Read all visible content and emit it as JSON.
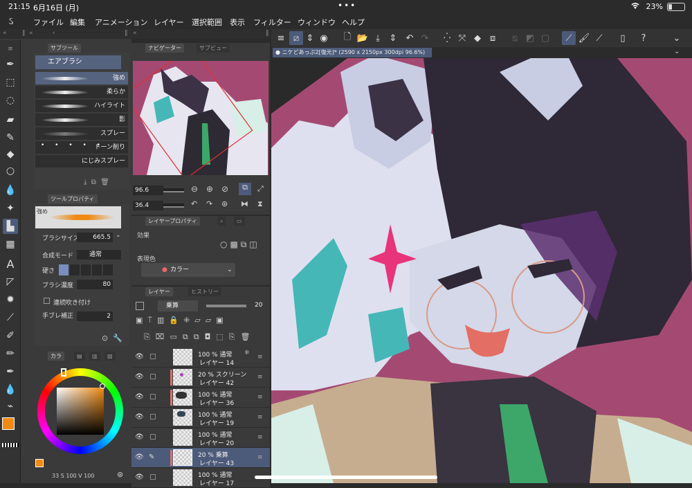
{
  "status": {
    "time": "21:15",
    "date": "6月16日 (月)",
    "battery": "23%"
  },
  "menu": [
    "ファイル",
    "編集",
    "アニメーション",
    "レイヤー",
    "選択範囲",
    "表示",
    "フィルター",
    "ウィンドウ",
    "ヘルプ"
  ],
  "subtool": {
    "tab": "サブツール",
    "group": "エアブラシ",
    "brushes": [
      "強め",
      "柔らか",
      "ハイライト",
      "影",
      "スプレー",
      "トーン削り",
      "にじみスプレー"
    ]
  },
  "toolprop": {
    "tab": "ツールプロパティ",
    "preview_label": "強め",
    "brush_size_label": "ブラシサイズ",
    "brush_size": "665.5",
    "blend_label": "合成モード",
    "blend": "通常",
    "hardness_label": "硬さ",
    "density_label": "ブラシ濃度",
    "density": "80",
    "continuous": "連続吹き付け",
    "stabilize_label": "手ブレ補正",
    "stabilize": "2"
  },
  "colorpanel": {
    "tab": "カラ",
    "readout": "33 S 100 V 100"
  },
  "navigator": {
    "tab": "ナビゲーター",
    "tab2": "サブビュー",
    "zoom": "96.6",
    "angle": "36.4"
  },
  "layerprop": {
    "tab": "レイヤープロパティ",
    "effect": "効果",
    "display_color": "表現色",
    "color_value": "カラー"
  },
  "layers": {
    "tab": "レイヤー",
    "tab2": "ヒストリー",
    "blend": "乗算",
    "opacity": "20",
    "list": [
      {
        "line1": "100 % 通常",
        "line2": "レイヤー 14",
        "marked": false,
        "selected": false,
        "eye": true
      },
      {
        "line1": "20 % スクリーン",
        "line2": "レイヤー 42",
        "marked": true,
        "selected": false,
        "eye": true
      },
      {
        "line1": "100 % 通常",
        "line2": "レイヤー 36",
        "marked": true,
        "selected": false,
        "eye": true
      },
      {
        "line1": "100 % 通常",
        "line2": "レイヤー 19",
        "marked": false,
        "selected": false,
        "eye": true
      },
      {
        "line1": "100 % 通常",
        "line2": "レイヤー 20",
        "marked": false,
        "selected": false,
        "eye": true
      },
      {
        "line1": "20 % 乗算",
        "line2": "レイヤー 43",
        "marked": true,
        "selected": true,
        "eye": true
      },
      {
        "line1": "100 % 通常",
        "line2": "レイヤー 17",
        "marked": false,
        "selected": false,
        "eye": true
      }
    ]
  },
  "document": {
    "title": "ニケどあっぷ2[復元]* (2590 x 2150px 300dpi 96.6%)"
  },
  "colors": {
    "accent": "#4d5b7a",
    "main_color": "#f08a13",
    "canvas_bg": "#a44a72"
  }
}
